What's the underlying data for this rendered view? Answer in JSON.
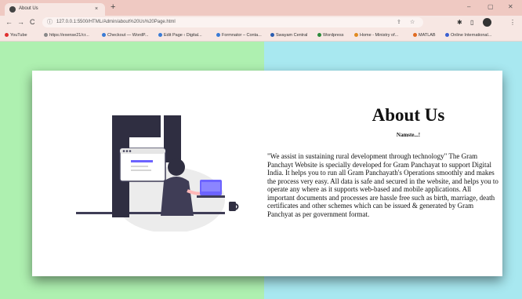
{
  "browser": {
    "tab": {
      "title": "About Us",
      "close_glyph": "×"
    },
    "new_tab_glyph": "+",
    "window": {
      "minimize_glyph": "–",
      "maximize_glyph": "▢",
      "close_glyph": "✕"
    },
    "nav": {
      "back_glyph": "←",
      "forward_glyph": "→",
      "reload_glyph": "C"
    },
    "url": "127.0.0.1:5500/HTML/Admin/about%20Us%20Page.html",
    "bookmarks": [
      {
        "label": "YouTube",
        "color": "#e03030"
      },
      {
        "label": "https://exense21/cr...",
        "color": "#888888"
      },
      {
        "label": "Checkout — WordP...",
        "color": "#3a7bd5"
      },
      {
        "label": "Edit Page ‹ Digital...",
        "color": "#3a7bd5"
      },
      {
        "label": "Formnator – Conta...",
        "color": "#3a7bd5"
      },
      {
        "label": "Swayam Central",
        "color": "#2a5db0"
      },
      {
        "label": "Wordpress",
        "color": "#2a8a3a"
      },
      {
        "label": "Home - Ministry of...",
        "color": "#e08a20"
      },
      {
        "label": "MATLAB",
        "color": "#e06a20"
      },
      {
        "label": "Online International...",
        "color": "#3a5fd0"
      }
    ]
  },
  "page": {
    "heading": "About Us",
    "subheading": "Namste...!",
    "description": "\"We assist in sustaining rural development through technology\" The Gram Panchayt Website is specially developed for Gram Panchayat to support Digital India. It helps you to run all Gram Panchayath's Operations smoothly and makes the process very easy. All data is safe and secured in the website, and helps you to operate any where as it supports web-based and mobile applications. All important documents and processes are hassle free such as birth, marriage, death certificates and other schemes which can be issued & generated by Gram Panchyat as per government format.",
    "illustration": "person-at-laptop-illustration"
  },
  "colors": {
    "bg_left": "#aef0b0",
    "bg_right": "#a8e8f0",
    "accent": "#6c63ff",
    "figure_dark": "#2f2e41"
  }
}
